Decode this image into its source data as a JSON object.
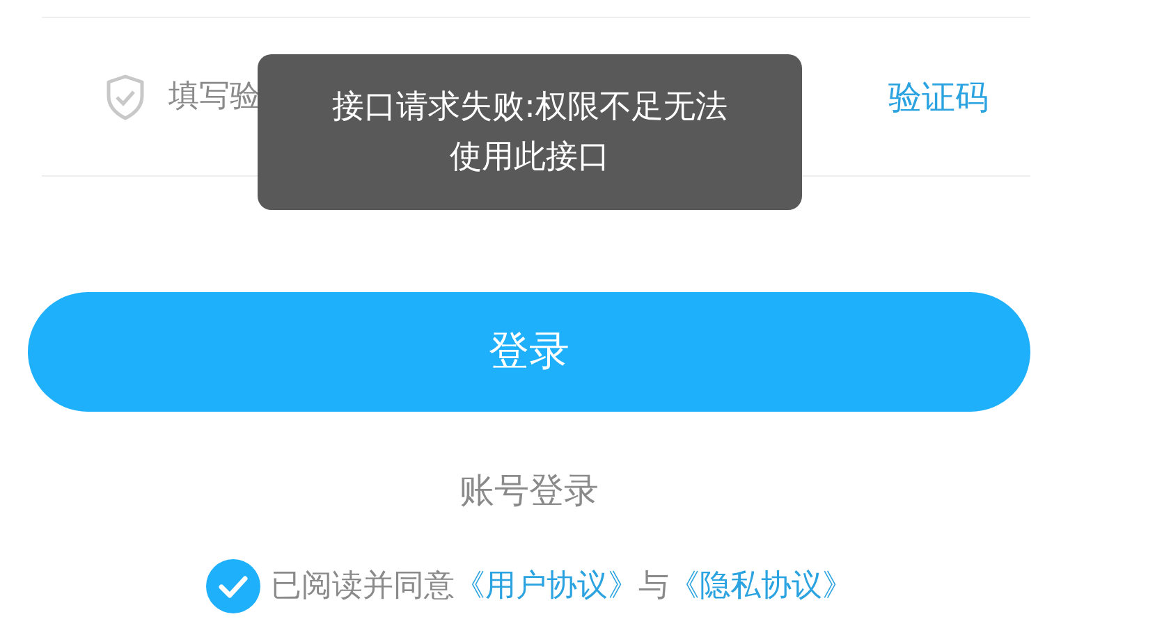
{
  "code_field": {
    "placeholder": "填写验",
    "action": "验证码"
  },
  "toast": {
    "lines": [
      "接口请求失败:权限不足无法",
      "使用此接口"
    ]
  },
  "login_button": "登录",
  "account_login": "账号登录",
  "agreement": {
    "checked": true,
    "text": "已阅读并同意",
    "links": [
      "《用户协议》",
      "《隐私协议》"
    ],
    "joiner": "与"
  }
}
